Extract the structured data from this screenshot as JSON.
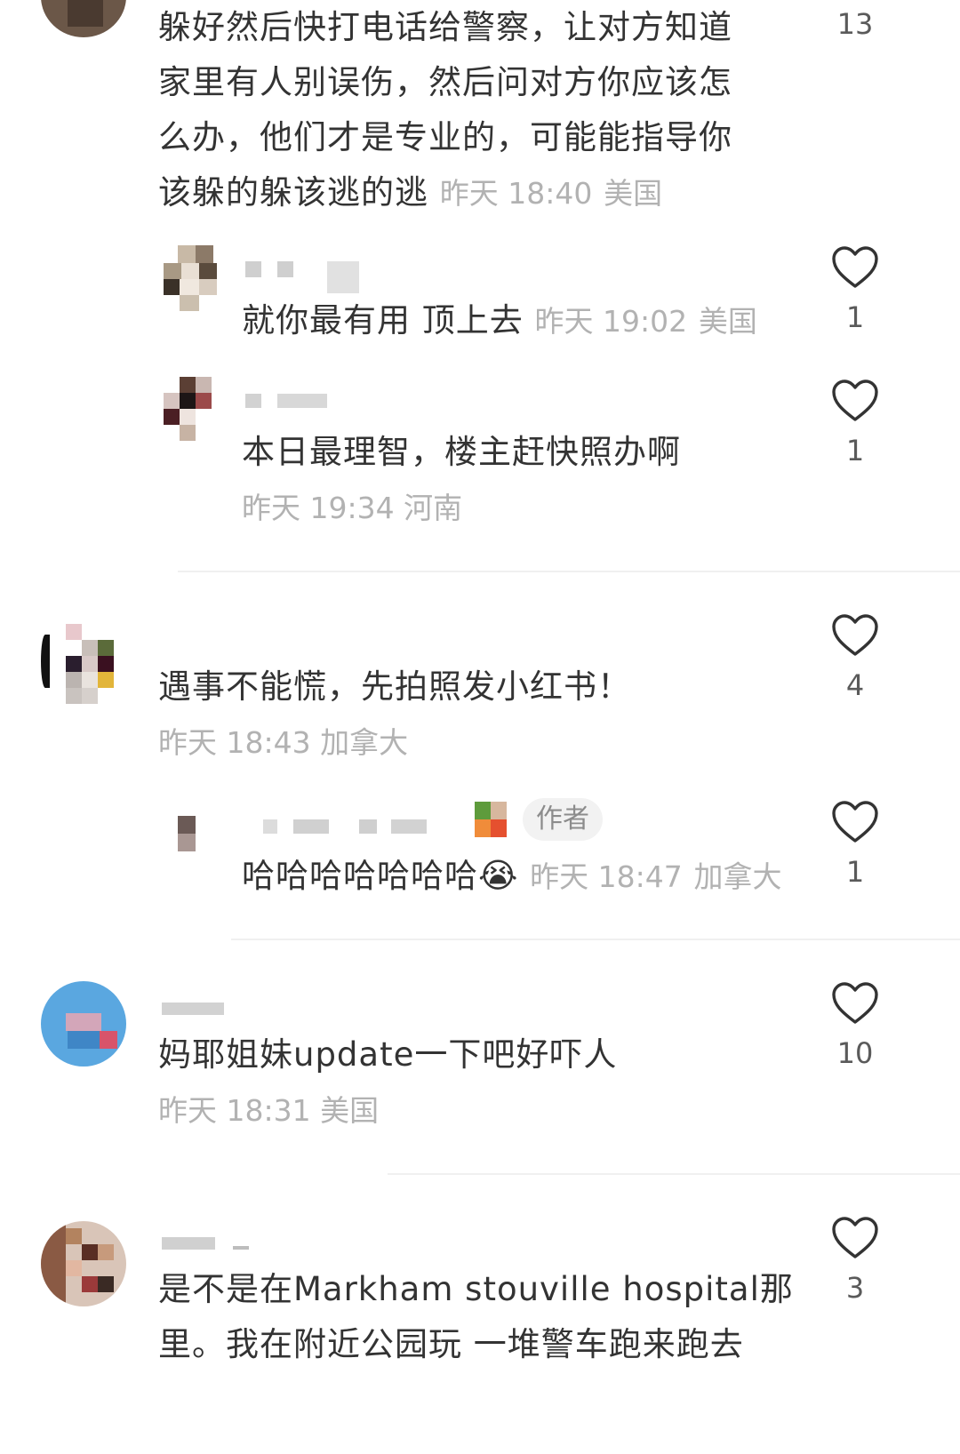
{
  "comments": [
    {
      "lines": [
        "躲好然后快打电话给警察，让对方知道",
        "家里有人别误伤，然后问对方你应该怎",
        "么办，他们才是专业的，可能能指导你",
        "该躲的躲该逃的逃"
      ],
      "time": "昨天 18:40",
      "location": "美国",
      "likes": "13"
    },
    {
      "text": "就你最有用  顶上去",
      "time": "昨天 19:02",
      "location": "美国",
      "likes": "1"
    },
    {
      "text": "本日最理智，楼主赶快照办啊",
      "time": "昨天 19:34",
      "location": "河南",
      "likes": "1"
    },
    {
      "text": "遇事不能慌，先拍照发小红书！",
      "time": "昨天 18:43",
      "location": "加拿大",
      "likes": "4"
    },
    {
      "text": "哈哈哈哈哈哈哈",
      "emoji": "😭",
      "badge": "作者",
      "time": "昨天 18:47",
      "location": "加拿大",
      "likes": "1"
    },
    {
      "text": "妈耶姐妹update一下吧好吓人",
      "time": "昨天 18:31",
      "location": "美国",
      "likes": "10"
    },
    {
      "lines": [
        "是不是在Markham stouville hospital那",
        "里。我在附近公园玩 一堆警车跑来跑去"
      ],
      "likes": "3"
    }
  ],
  "icons": {
    "like": "heart-outline-icon",
    "emoji": "crying-laughing-face-icon"
  },
  "colors": {
    "text": "#333333",
    "meta": "#b2b2b2",
    "count": "#5a5a5a",
    "badge_bg": "#f2f2f2"
  }
}
